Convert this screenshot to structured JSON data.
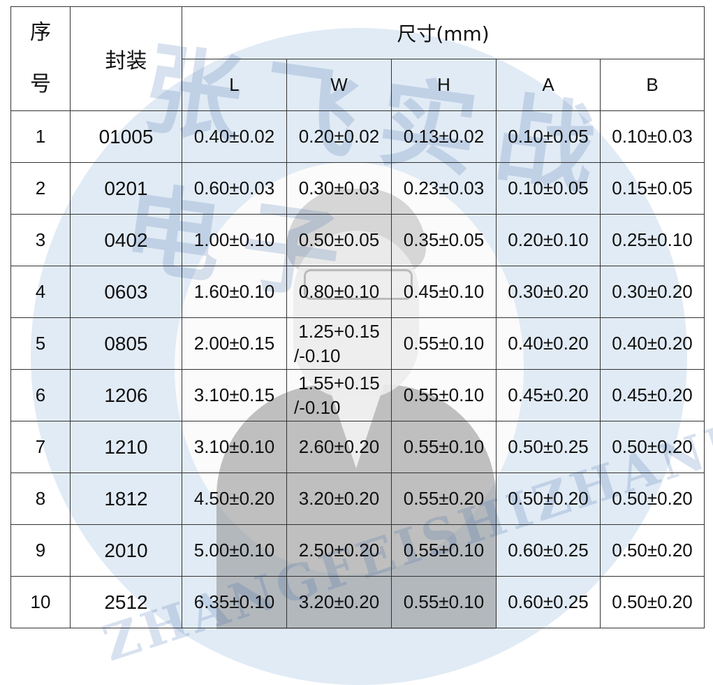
{
  "watermark": {
    "cn_text": "张飞实战电子",
    "en_text": "ZHANGFEISHIZHANDIANZI"
  },
  "table": {
    "header": {
      "index_label": "序号",
      "package_label": "封装",
      "dimension_label": "尺寸(mm)",
      "sub_headers": [
        "L",
        "W",
        "H",
        "A",
        "B"
      ]
    },
    "rows": [
      {
        "idx": "1",
        "pkg": "01005",
        "L": "0.40±0.02",
        "W": "0.20±0.02",
        "W2": "",
        "H": "0.13±0.02",
        "A": "0.10±0.05",
        "B": "0.10±0.03"
      },
      {
        "idx": "2",
        "pkg": "0201",
        "L": "0.60±0.03",
        "W": "0.30±0.03",
        "W2": "",
        "H": "0.23±0.03",
        "A": "0.10±0.05",
        "B": "0.15±0.05"
      },
      {
        "idx": "3",
        "pkg": "0402",
        "L": "1.00±0.10",
        "W": "0.50±0.05",
        "W2": "",
        "H": "0.35±0.05",
        "A": "0.20±0.10",
        "B": "0.25±0.10"
      },
      {
        "idx": "4",
        "pkg": "0603",
        "L": "1.60±0.10",
        "W": "0.80±0.10",
        "W2": "",
        "H": "0.45±0.10",
        "A": "0.30±0.20",
        "B": "0.30±0.20"
      },
      {
        "idx": "5",
        "pkg": "0805",
        "L": "2.00±0.15",
        "W": "1.25+0.15",
        "W2": "/-0.10",
        "H": "0.55±0.10",
        "A": "0.40±0.20",
        "B": "0.40±0.20"
      },
      {
        "idx": "6",
        "pkg": "1206",
        "L": "3.10±0.15",
        "W": "1.55+0.15",
        "W2": "/-0.10",
        "H": "0.55±0.10",
        "A": "0.45±0.20",
        "B": "0.45±0.20"
      },
      {
        "idx": "7",
        "pkg": "1210",
        "L": "3.10±0.10",
        "W": "2.60±0.20",
        "W2": "",
        "H": "0.55±0.10",
        "A": "0.50±0.25",
        "B": "0.50±0.20"
      },
      {
        "idx": "8",
        "pkg": "1812",
        "L": "4.50±0.20",
        "W": "3.20±0.20",
        "W2": "",
        "H": "0.55±0.20",
        "A": "0.50±0.20",
        "B": "0.50±0.20"
      },
      {
        "idx": "9",
        "pkg": "2010",
        "L": "5.00±0.10",
        "W": "2.50±0.20",
        "W2": "",
        "H": "0.55±0.10",
        "A": "0.60±0.25",
        "B": "0.50±0.20"
      },
      {
        "idx": "10",
        "pkg": "2512",
        "L": "6.35±0.10",
        "W": "3.20±0.20",
        "W2": "",
        "H": "0.55±0.10",
        "A": "0.60±0.25",
        "B": "0.50±0.20"
      }
    ]
  }
}
